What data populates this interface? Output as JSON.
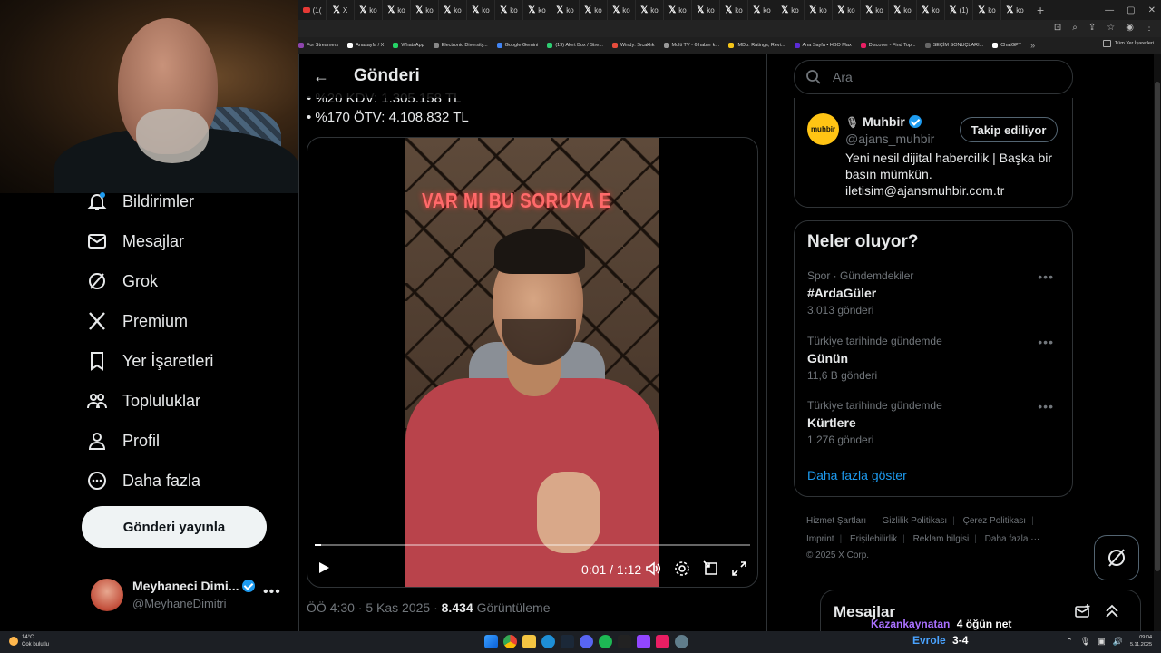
{
  "browser": {
    "tabs": [
      {
        "icon": "youtube",
        "label": "(1("
      },
      {
        "icon": "x",
        "label": "X"
      },
      {
        "icon": "x",
        "label": "ko"
      },
      {
        "icon": "x",
        "label": "ko"
      },
      {
        "icon": "x",
        "label": "ko"
      },
      {
        "icon": "x",
        "label": "ko"
      },
      {
        "icon": "x",
        "label": "ko"
      },
      {
        "icon": "x",
        "label": "ko"
      },
      {
        "icon": "x",
        "label": "ko"
      },
      {
        "icon": "x",
        "label": "ko"
      },
      {
        "icon": "x",
        "label": "ko"
      },
      {
        "icon": "x",
        "label": "ko"
      },
      {
        "icon": "x",
        "label": "ko"
      },
      {
        "icon": "x",
        "label": "ko"
      },
      {
        "icon": "x",
        "label": "ko"
      },
      {
        "icon": "x",
        "label": "ko"
      },
      {
        "icon": "x",
        "label": "ko"
      },
      {
        "icon": "x",
        "label": "ko"
      },
      {
        "icon": "x",
        "label": "ko"
      },
      {
        "icon": "x",
        "label": "ko"
      },
      {
        "icon": "x",
        "label": "ko"
      },
      {
        "icon": "x",
        "label": "ko"
      },
      {
        "icon": "x",
        "label": "ko"
      },
      {
        "icon": "x",
        "label": "(1)"
      },
      {
        "icon": "x",
        "label": "ko"
      },
      {
        "icon": "x",
        "label": "ko"
      }
    ],
    "bookmarks": [
      "For Streamers",
      "Anasayfa / X",
      "WhatsApp",
      "Electronic Diversity...",
      "Google Gemini",
      "(19) Alert Box / Stre...",
      "Windy: Sıcaklık",
      "Multi TV - 6 haber k...",
      "IMDb: Ratings, Revi...",
      "Ana Sayfa • HBO Max",
      "Discover - Find Top...",
      "SEÇİM SONUÇLARI...",
      "ChatGPT"
    ],
    "bookmarks_right": "Tüm Yer İşaretleri"
  },
  "nav": {
    "items": [
      {
        "label": "Bildirimler",
        "icon": "bell-icon"
      },
      {
        "label": "Mesajlar",
        "icon": "mail-icon"
      },
      {
        "label": "Grok",
        "icon": "grok-icon"
      },
      {
        "label": "Premium",
        "icon": "x-logo-icon"
      },
      {
        "label": "Yer İşaretleri",
        "icon": "bookmark-icon"
      },
      {
        "label": "Topluluklar",
        "icon": "communities-icon"
      },
      {
        "label": "Profil",
        "icon": "profile-icon"
      },
      {
        "label": "Daha fazla",
        "icon": "more-circle-icon"
      }
    ],
    "post_button": "Gönderi yayınla",
    "account": {
      "name": "Meyhaneci Dimi...",
      "handle": "@MeyhaneDimitri"
    }
  },
  "main": {
    "header_title": "Gönderi",
    "tax_lines": [
      "• %20 KDV: 1.305.158 TL",
      "• %170 ÖTV: 4.108.832 TL"
    ],
    "video": {
      "overlay_text": "VAR MI BU SORUYA E",
      "time": "0:01 / 1:12",
      "progress": 0.014
    },
    "meta": {
      "time_date": "ÖÖ 4:30 · 5 Kas 2025 · ",
      "views": "8.434",
      "views_label": " Görüntüleme"
    }
  },
  "right": {
    "search_placeholder": "Ara",
    "profile": {
      "logo_text": "muhbir",
      "name": "Muhbir",
      "handle": "@ajans_muhbir",
      "follow_label": "Takip ediliyor",
      "bio": "Yeni nesil dijital habercilik | Başka bir basın mümkün. iletisim@ajansmuhbir.com.tr"
    },
    "trends_title": "Neler oluyor?",
    "trends": [
      {
        "context": "Spor · Gündemdekiler",
        "name": "#ArdaGüler",
        "count": "3.013 gönderi"
      },
      {
        "context": "Türkiye tarihinde gündemde",
        "name": "Günün",
        "count": "11,6 B gönderi"
      },
      {
        "context": "Türkiye tarihinde gündemde",
        "name": "Kürtlere",
        "count": "1.276 gönderi"
      }
    ],
    "show_more": "Daha fazla göster",
    "footer": {
      "row1": [
        "Hizmet Şartları",
        "Gizlilik Politikası",
        "Çerez Politikası"
      ],
      "row2": [
        "Imprint",
        "Erişilebilirlik",
        "Reklam bilgisi",
        "Daha fazla ···"
      ],
      "copyright": "© 2025 X Corp."
    },
    "messages_title": "Mesajlar"
  },
  "stream": {
    "line1_name": "Kazankaynatan",
    "line1_text": "4 öğün net",
    "line2_name": "Evrole",
    "line2_text": "3-4"
  },
  "taskbar": {
    "weather_temp": "14°C",
    "weather_text": "Çok bulutlu",
    "time": "09:04",
    "date": "5.11.2025"
  }
}
